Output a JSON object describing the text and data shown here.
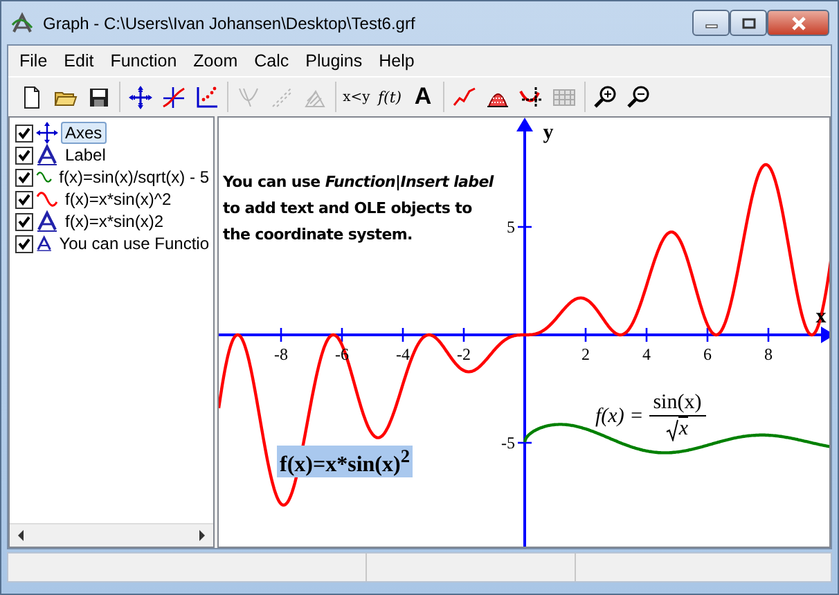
{
  "window": {
    "title": "Graph - C:\\Users\\Ivan Johansen\\Desktop\\Test6.grf"
  },
  "menu": [
    "File",
    "Edit",
    "Function",
    "Zoom",
    "Calc",
    "Plugins",
    "Help"
  ],
  "toolbar": [
    [
      {
        "kind": "new",
        "disabled": false
      },
      {
        "kind": "open",
        "disabled": false
      },
      {
        "kind": "save",
        "disabled": false
      }
    ],
    [
      {
        "kind": "axes",
        "disabled": false
      },
      {
        "kind": "function",
        "disabled": false
      },
      {
        "kind": "points",
        "disabled": false
      }
    ],
    [
      {
        "kind": "tangent",
        "disabled": true
      },
      {
        "kind": "relation",
        "disabled": true
      },
      {
        "kind": "shading",
        "disabled": true
      }
    ],
    [
      {
        "kind": "text",
        "label": "x<y",
        "disabled": false
      },
      {
        "kind": "text",
        "label": "f(t)",
        "disabled": false
      },
      {
        "kind": "text",
        "label": "A",
        "disabled": false
      }
    ],
    [
      {
        "kind": "curve",
        "disabled": false
      },
      {
        "kind": "area",
        "disabled": false
      },
      {
        "kind": "trace",
        "disabled": false
      },
      {
        "kind": "table",
        "disabled": true
      }
    ],
    [
      {
        "kind": "zoomin",
        "disabled": false
      },
      {
        "kind": "zoomout",
        "disabled": false
      }
    ]
  ],
  "sidebar": {
    "items": [
      {
        "kind": "axes",
        "label": "Axes",
        "checked": true,
        "selected": true
      },
      {
        "kind": "label",
        "label": "Label",
        "checked": true,
        "selected": false
      },
      {
        "kind": "function",
        "label": "f(x)=sin(x)/sqrt(x) - 5",
        "checked": true,
        "selected": false,
        "color": "#008000"
      },
      {
        "kind": "function",
        "label": "f(x)=x*sin(x)^2",
        "checked": true,
        "selected": false,
        "color": "#ff0000"
      },
      {
        "kind": "label",
        "label": "f(x)=x*sin(x)2",
        "checked": true,
        "selected": false
      },
      {
        "kind": "label",
        "label": "You can use Functio",
        "checked": true,
        "selected": false
      }
    ]
  },
  "graph": {
    "x_axis_label": "x",
    "y_axis_label": "y",
    "x_ticks": [
      "-8",
      "-6",
      "-4",
      "-2",
      "2",
      "4",
      "6",
      "8"
    ],
    "y_ticks": [
      "5",
      "-5"
    ],
    "labels": [
      {
        "kind": "text",
        "lines": [
          "You can use *Function|Insert label*",
          "to add text and OLE objects to",
          "the coordinate system."
        ]
      },
      {
        "kind": "formula",
        "text": "f(x)=x*sin(x)$^{2}$",
        "selected": true
      },
      {
        "kind": "equation",
        "lhs": "f(x) =",
        "numerator": "sin(x)",
        "denominator": "x"
      }
    ]
  }
}
